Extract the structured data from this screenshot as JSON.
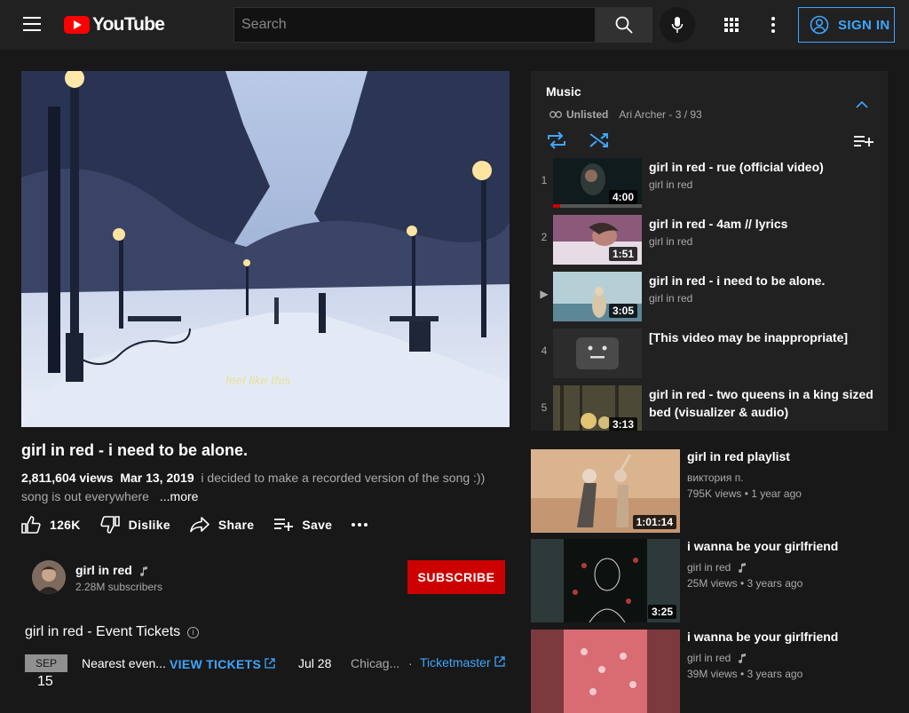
{
  "header": {
    "logo_text": "YouTube",
    "search_placeholder": "Search",
    "sign_in_label": "SIGN IN"
  },
  "video": {
    "caption": "feel like this",
    "title": "girl in red - i need to be alone.",
    "views": "2,811,604 views",
    "date": "Mar 13, 2019",
    "description_line1": "i decided to make a recorded version of the song :))",
    "description_line2": "song is out everywhere",
    "more_label": "...more",
    "likes": "126K",
    "dislike_label": "Dislike",
    "share_label": "Share",
    "save_label": "Save"
  },
  "channel": {
    "name": "girl in red",
    "subscribers": "2.28M subscribers",
    "subscribe_label": "SUBSCRIBE"
  },
  "events": {
    "title": "girl in red - Event Tickets",
    "info_icon": "i",
    "row": {
      "month": "SEP",
      "day": "15",
      "name": "Nearest even...",
      "view_label": "VIEW TICKETS",
      "date": "Jul 28",
      "city": "Chicag...",
      "sep": "·",
      "vendor": "Ticketmaster"
    }
  },
  "playlist": {
    "title": "Music",
    "visibility": "Unlisted",
    "owner_position": "Ari Archer - 3 / 93",
    "current_marker": "▶",
    "items": [
      {
        "index": "1",
        "title": "girl in red - rue (official video)",
        "channel": "girl in red",
        "duration": "4:00"
      },
      {
        "index": "2",
        "title": "girl in red - 4am // lyrics",
        "channel": "girl in red",
        "duration": "1:51"
      },
      {
        "index": "▶",
        "title": "girl in red - i need to be alone.",
        "channel": "girl in red",
        "duration": "3:05"
      },
      {
        "index": "4",
        "title": "[This video may be inappropriate]",
        "channel": "",
        "duration": ""
      },
      {
        "index": "5",
        "title": "girl in red - two queens in a king sized bed (visualizer & audio)",
        "channel": "",
        "duration": "3:13"
      }
    ]
  },
  "recommended": [
    {
      "title": "girl in red playlist",
      "channel": "виктория п.",
      "meta": "795K views • 1 year ago",
      "duration": "1:01:14"
    },
    {
      "title": "i wanna be your girlfriend",
      "channel": "girl in red",
      "meta": "25M views • 3 years ago",
      "duration": "3:25"
    },
    {
      "title": "i wanna be your girlfriend",
      "channel": "girl in red",
      "meta": "39M views • 3 years ago",
      "duration": ""
    }
  ],
  "colors": {
    "accent_blue": "#3ea6ff",
    "subscribe_red": "#cc0000",
    "background": "#181818"
  }
}
